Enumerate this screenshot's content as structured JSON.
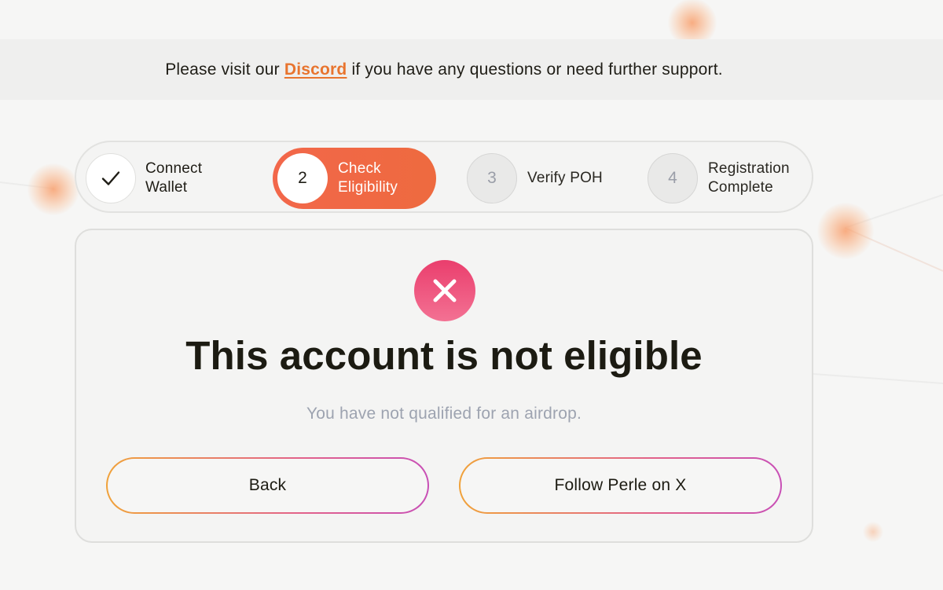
{
  "banner": {
    "prefix": "Please visit our ",
    "link_label": "Discord",
    "suffix": " if you have any questions or need further support."
  },
  "stepper": {
    "steps": [
      {
        "number": "",
        "icon": "check-icon",
        "line1": "Connect",
        "line2": "Wallet",
        "state": "completed"
      },
      {
        "number": "2",
        "line1": "Check",
        "line2": "Eligibility",
        "state": "active"
      },
      {
        "number": "3",
        "line1": "Verify POH",
        "line2": "",
        "state": "pending"
      },
      {
        "number": "4",
        "line1": "Registration",
        "line2": "Complete",
        "state": "pending"
      }
    ]
  },
  "result": {
    "icon": "close-icon",
    "title": "This account is not eligible",
    "subtitle": "You have not qualified for an airdrop."
  },
  "actions": {
    "back_label": "Back",
    "follow_label": "Follow Perle on X"
  },
  "colors": {
    "accent": "#ee6a3f",
    "link": "#e8742e",
    "error": "#ea3e6d"
  }
}
